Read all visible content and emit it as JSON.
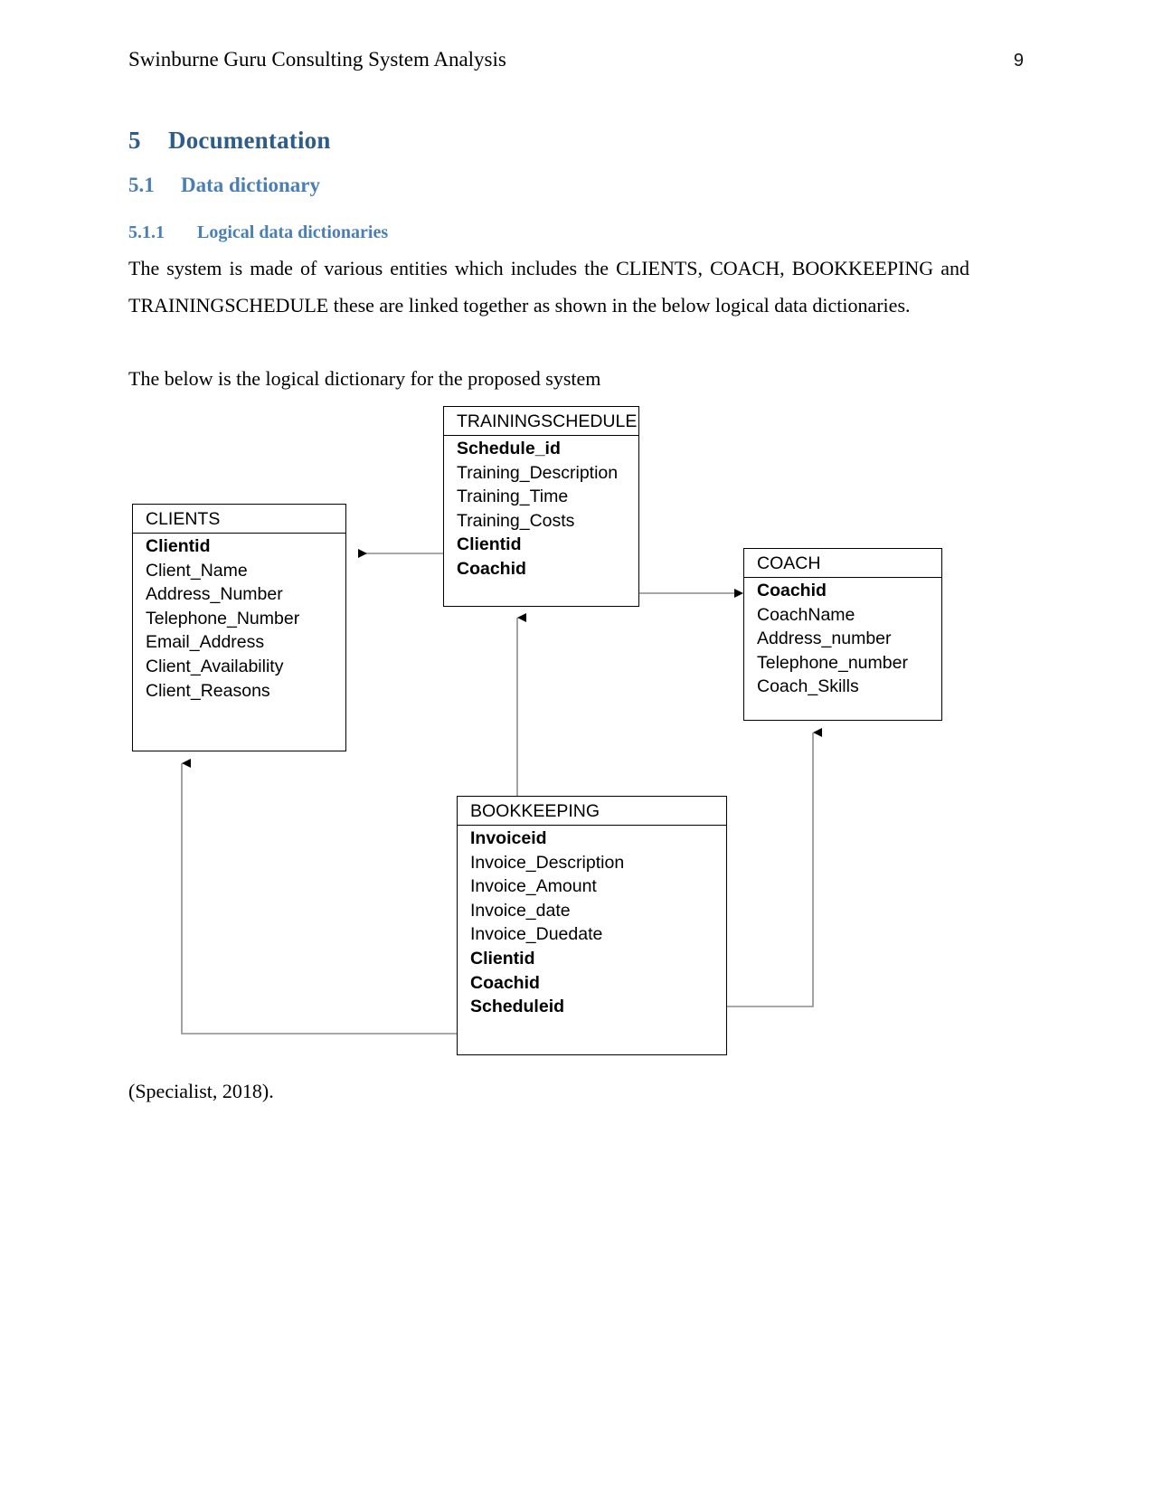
{
  "header": {
    "title": "Swinburne Guru Consulting System Analysis",
    "page_number": "9"
  },
  "headings": {
    "h1_number": "5",
    "h1_text": "Documentation",
    "h2_number": "5.1",
    "h2_text": "Data dictionary",
    "h3_number": "5.1.1",
    "h3_text": "Logical data dictionaries"
  },
  "body": {
    "paragraph_1": "The system is made of various entities which includes the CLIENTS, COACH, BOOKKEEPING and TRAININGSCHEDULE these are linked together as shown in the below logical data dictionaries.",
    "paragraph_2": "The below is the logical dictionary for the proposed system",
    "caption": "(Specialist, 2018)."
  },
  "colors": {
    "heading_1": "#2f5d8a",
    "heading_2_3": "#4a7fb5",
    "text": "#000000",
    "box_border": "#000000",
    "connector": "#808080",
    "arrowhead": "#000000",
    "page_background": "#ffffff"
  },
  "diagram": {
    "type": "entity-relationship-logical-data-dictionary",
    "entities": [
      {
        "id": "trainingschedule",
        "title": "TRAININGSCHEDULE",
        "fields": [
          {
            "name": "Schedule_id",
            "key": true
          },
          {
            "name": "Training_Description",
            "key": false
          },
          {
            "name": "Training_Time",
            "key": false
          },
          {
            "name": "Training_Costs",
            "key": false
          },
          {
            "name": "Clientid",
            "key": true
          },
          {
            "name": "Coachid",
            "key": true
          }
        ]
      },
      {
        "id": "clients",
        "title": "CLIENTS",
        "fields": [
          {
            "name": "Clientid",
            "key": true
          },
          {
            "name": "Client_Name",
            "key": false
          },
          {
            "name": "Address_Number",
            "key": false
          },
          {
            "name": "Telephone_Number",
            "key": false
          },
          {
            "name": "Email_Address",
            "key": false
          },
          {
            "name": "Client_Availability",
            "key": false
          },
          {
            "name": "Client_Reasons",
            "key": false
          }
        ]
      },
      {
        "id": "coach",
        "title": "COACH",
        "fields": [
          {
            "name": "Coachid",
            "key": true
          },
          {
            "name": "CoachName",
            "key": false
          },
          {
            "name": "Address_number",
            "key": false
          },
          {
            "name": "Telephone_number",
            "key": false
          },
          {
            "name": "Coach_Skills",
            "key": false
          }
        ]
      },
      {
        "id": "bookkeeping",
        "title": "BOOKKEEPING",
        "fields": [
          {
            "name": "Invoiceid",
            "key": true
          },
          {
            "name": "Invoice_Description",
            "key": false
          },
          {
            "name": "Invoice_Amount",
            "key": false
          },
          {
            "name": "Invoice_date",
            "key": false
          },
          {
            "name": "Invoice_Duedate",
            "key": false
          },
          {
            "name": "Clientid",
            "key": true
          },
          {
            "name": "Coachid",
            "key": true
          },
          {
            "name": "Scheduleid",
            "key": true
          }
        ]
      }
    ],
    "relationships": [
      {
        "from": "trainingschedule",
        "to": "clients",
        "direction": "left"
      },
      {
        "from": "trainingschedule",
        "to": "coach",
        "direction": "right"
      },
      {
        "from": "bookkeeping",
        "to": "trainingschedule",
        "direction": "up"
      },
      {
        "from": "bookkeeping",
        "to": "clients",
        "direction": "up-left"
      },
      {
        "from": "bookkeeping",
        "to": "coach",
        "direction": "up-right"
      }
    ]
  }
}
